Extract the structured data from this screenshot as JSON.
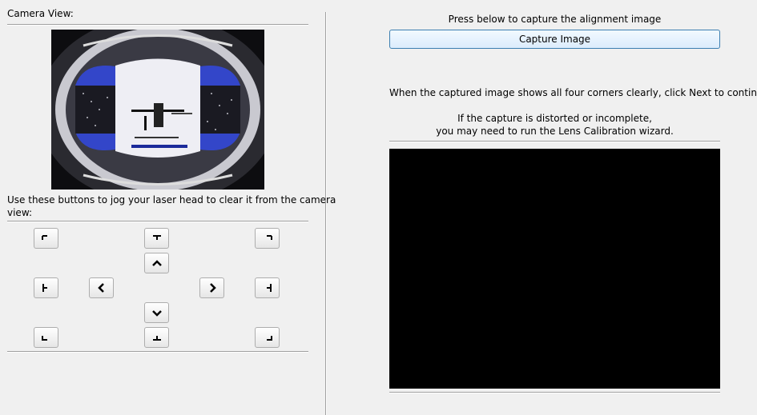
{
  "left": {
    "camera_title": "Camera View:",
    "jog_instructions_line1": "Use these buttons to jog your laser head to clear it from the camera",
    "jog_instructions_line2": "view:"
  },
  "right": {
    "capture_prompt": "Press below to capture the alignment image",
    "capture_button_label": "Capture Image",
    "next_instruction": "When the captured image shows all four corners clearly, click Next to continue",
    "distortion_line1": "If the capture is distorted or incomplete,",
    "distortion_line2": "you may need to run the Lens Calibration wizard."
  },
  "colors": {
    "accent_border": "#3c7fb1",
    "preview_background": "#000000"
  }
}
